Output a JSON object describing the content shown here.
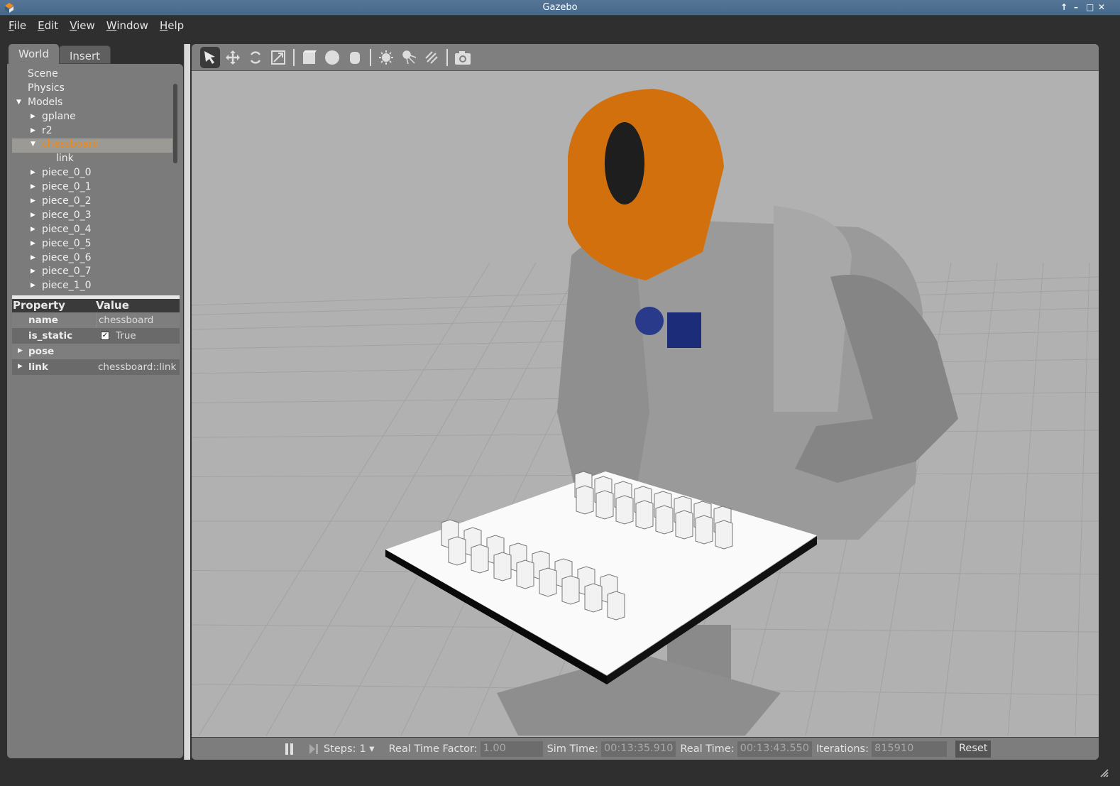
{
  "window": {
    "title": "Gazebo",
    "controls": [
      "↑",
      "–",
      "□",
      "✕"
    ]
  },
  "menu": [
    "File",
    "Edit",
    "View",
    "Window",
    "Help"
  ],
  "tabs": [
    {
      "label": "World",
      "active": true
    },
    {
      "label": "Insert",
      "active": false
    }
  ],
  "tree": [
    {
      "label": "Scene",
      "level": 0,
      "arrow": ""
    },
    {
      "label": "Physics",
      "level": 0,
      "arrow": ""
    },
    {
      "label": "Models",
      "level": 0,
      "arrow": "down"
    },
    {
      "label": "gplane",
      "level": 1,
      "arrow": "right"
    },
    {
      "label": "r2",
      "level": 1,
      "arrow": "right"
    },
    {
      "label": "chessboard",
      "level": 1,
      "arrow": "down",
      "selected": true
    },
    {
      "label": "link",
      "level": 2,
      "arrow": ""
    },
    {
      "label": "piece_0_0",
      "level": 1,
      "arrow": "right"
    },
    {
      "label": "piece_0_1",
      "level": 1,
      "arrow": "right"
    },
    {
      "label": "piece_0_2",
      "level": 1,
      "arrow": "right"
    },
    {
      "label": "piece_0_3",
      "level": 1,
      "arrow": "right"
    },
    {
      "label": "piece_0_4",
      "level": 1,
      "arrow": "right"
    },
    {
      "label": "piece_0_5",
      "level": 1,
      "arrow": "right"
    },
    {
      "label": "piece_0_6",
      "level": 1,
      "arrow": "right"
    },
    {
      "label": "piece_0_7",
      "level": 1,
      "arrow": "right"
    },
    {
      "label": "piece_1_0",
      "level": 1,
      "arrow": "right"
    }
  ],
  "properties": {
    "header": {
      "property": "Property",
      "value": "Value"
    },
    "rows": [
      {
        "key": "name",
        "value": "chessboard",
        "expandable": false
      },
      {
        "key": "is_static",
        "value": "True",
        "checkbox": true,
        "checked": true
      },
      {
        "key": "pose",
        "value": "",
        "expandable": true
      },
      {
        "key": "link",
        "value": "chessboard::link",
        "expandable": true
      }
    ]
  },
  "toolbar": {
    "tools": [
      "select-arrow",
      "translate",
      "rotate",
      "scale",
      "box",
      "sphere",
      "cylinder",
      "point-light",
      "spot-light",
      "directional-light",
      "screenshot"
    ],
    "active": "select-arrow"
  },
  "status": {
    "steps_label": "Steps:",
    "steps_value": "1",
    "rtf_label": "Real Time Factor:",
    "rtf_value": "1.00",
    "sim_label": "Sim Time:",
    "sim_value": "00:13:35.910",
    "real_label": "Real Time:",
    "real_value": "00:13:43.550",
    "iter_label": "Iterations:",
    "iter_value": "815910",
    "reset_label": "Reset"
  },
  "colors": {
    "selected_text": "#f08b1c",
    "helmet": "#d2700e",
    "titlebar": "#4e6f90"
  }
}
